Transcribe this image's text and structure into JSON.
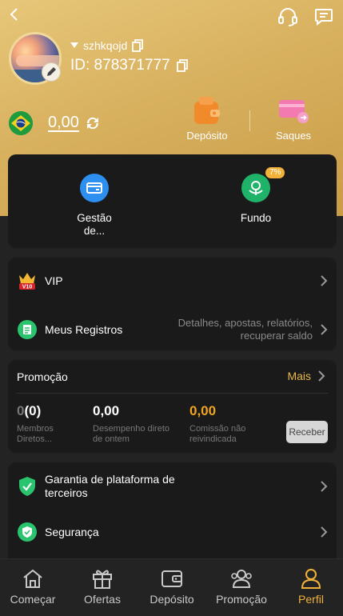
{
  "profile": {
    "username": "szhkqojd",
    "id_label": "ID: 878371777"
  },
  "wallet": {
    "balance": "0,00",
    "deposit_label": "Depósito",
    "withdraw_label": "Saques"
  },
  "quick_tiles": {
    "gestao_label": "Gestão de...",
    "fundo_label": "Fundo",
    "fundo_badge": "7%"
  },
  "menu": {
    "vip_label": "VIP",
    "vip_badge": "V10",
    "records_label": "Meus Registros",
    "records_hint": "Detalhes, apostas, relatórios, recuperar saldo"
  },
  "promo": {
    "title": "Promoção",
    "more_label": "Mais",
    "members_value_a": "0",
    "members_value_b": "(0)",
    "members_label": "Membros Diretos...",
    "performance_value": "0,00",
    "performance_label": "Desempenho direto de ontem",
    "commission_value": "0,00",
    "commission_label": "Comissão não reivindicada",
    "receive_label": "Receber"
  },
  "security": {
    "guarantee_label": "Garantia de plataforma de terceiros",
    "security_label": "Segurança"
  },
  "tabs": [
    {
      "label": "Começar"
    },
    {
      "label": "Ofertas"
    },
    {
      "label": "Depósito"
    },
    {
      "label": "Promoção"
    },
    {
      "label": "Perfil"
    }
  ],
  "colors": {
    "accent": "#f2b23a",
    "hero_gold": "#d8b15f",
    "card_bg": "#1a1a1a",
    "page_bg": "#232323"
  }
}
